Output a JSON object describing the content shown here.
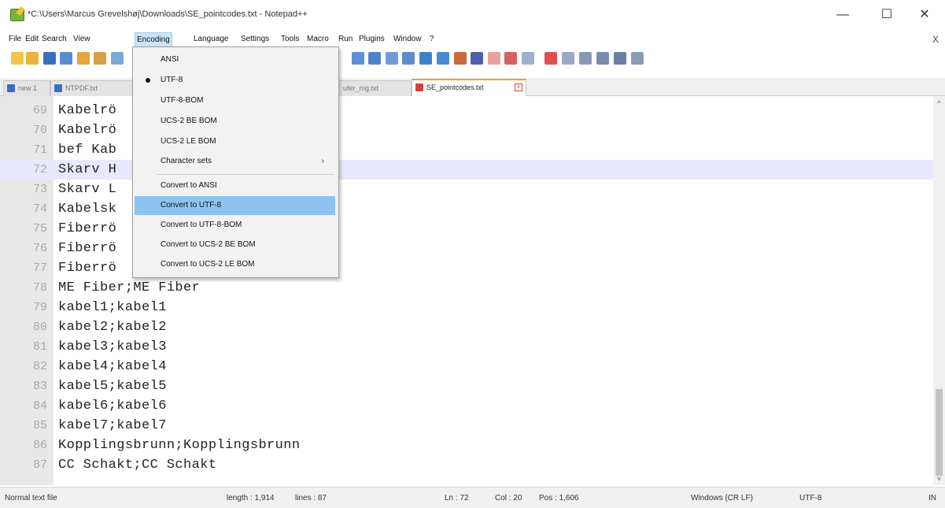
{
  "window": {
    "title": "*C:\\Users\\Marcus Grevelshøj\\Downloads\\SE_pointcodes.txt - Notepad++",
    "minimize": "—",
    "maximize": "☐",
    "close": "✕"
  },
  "menu": {
    "items": [
      "File",
      "Edit",
      "Search",
      "View",
      "Encoding",
      "Language",
      "Settings",
      "Tools",
      "Macro",
      "Run",
      "Plugins",
      "Window",
      "?"
    ],
    "active": "Encoding",
    "close_x": "X"
  },
  "tabs": [
    {
      "label": "new 1",
      "style": "blue"
    },
    {
      "label": "NTPDF.txt",
      "style": "blue"
    },
    {
      "label": "ufer_mg.txt",
      "style": "blue"
    },
    {
      "label": "SE_pointcodes.txt",
      "style": "red",
      "active": true
    }
  ],
  "encoding_menu": {
    "items": [
      {
        "label": "ANSI"
      },
      {
        "label": "UTF-8",
        "checked": true
      },
      {
        "label": "UTF-8-BOM"
      },
      {
        "label": "UCS-2 BE BOM"
      },
      {
        "label": "UCS-2 LE BOM"
      },
      {
        "label": "Character sets",
        "submenu": true,
        "arrow": "›"
      },
      {
        "label": "Convert to ANSI"
      },
      {
        "label": "Convert to UTF-8",
        "highlighted": true
      },
      {
        "label": "Convert to UTF-8-BOM"
      },
      {
        "label": "Convert to UCS-2 BE BOM"
      },
      {
        "label": "Convert to UCS-2 LE BOM"
      }
    ]
  },
  "editor": {
    "current_line": 72,
    "lines": [
      {
        "num": "69",
        "text": "Kabelrö"
      },
      {
        "num": "70",
        "text": "Kabelrö"
      },
      {
        "num": "71",
        "text": "bef Kab"
      },
      {
        "num": "72",
        "text": "Skarv H"
      },
      {
        "num": "73",
        "text": "Skarv L"
      },
      {
        "num": "74",
        "text": "Kabelsk"
      },
      {
        "num": "75",
        "text": "Fiberrö                     pe"
      },
      {
        "num": "76",
        "text": "Fiberrö"
      },
      {
        "num": "77",
        "text": "Fiberrö"
      },
      {
        "num": "78",
        "text": "ME Fiber;ME Fiber"
      },
      {
        "num": "79",
        "text": "kabel1;kabel1"
      },
      {
        "num": "80",
        "text": "kabel2;kabel2"
      },
      {
        "num": "81",
        "text": "kabel3;kabel3"
      },
      {
        "num": "82",
        "text": "kabel4;kabel4"
      },
      {
        "num": "83",
        "text": "kabel5;kabel5"
      },
      {
        "num": "84",
        "text": "kabel6;kabel6"
      },
      {
        "num": "85",
        "text": "kabel7;kabel7"
      },
      {
        "num": "86",
        "text": "Kopplingsbrunn;Kopplingsbrunn"
      },
      {
        "num": "87",
        "text": "CC Schakt;CC Schakt"
      }
    ]
  },
  "scrollbar": {
    "up": "^",
    "down": "v"
  },
  "status": {
    "file_type": "Normal text file",
    "length": "length : 1,914",
    "lines": "lines : 87",
    "ln": "Ln : 72",
    "col": "Col : 20",
    "pos": "Pos : 1,606",
    "eol": "Windows (CR LF)",
    "encoding": "UTF-8",
    "mode": "IN"
  },
  "colors": {
    "highlight": "#8cc3f1",
    "current_line": "#e8e8ff",
    "active_tab_accent": "#f0a030"
  }
}
